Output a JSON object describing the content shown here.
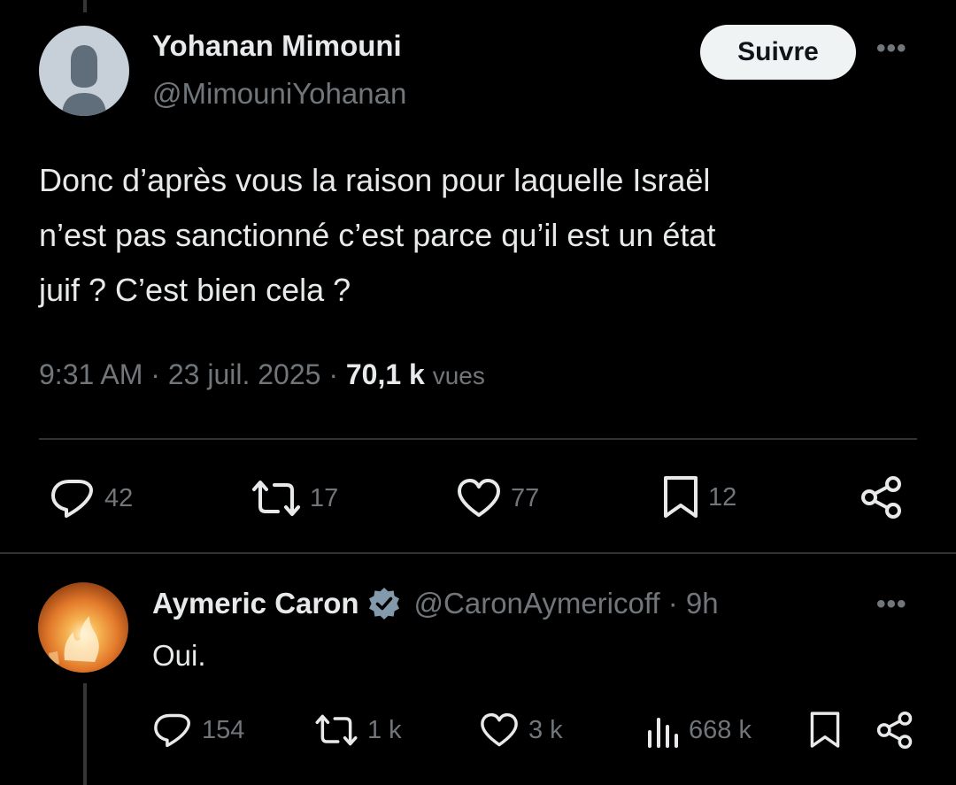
{
  "tweet": {
    "author_name": "Yohanan Mimouni",
    "author_handle": "@MimouniYohanan",
    "follow_label": "Suivre",
    "more_icon": "•••",
    "text_lines": [
      "Donc d’après vous la raison pour laquelle Israël",
      "n’est pas sanctionné c’est parce qu’il est un état",
      "juif ? C’est bien cela ?"
    ],
    "time": "9:31 AM",
    "date": "23 juil. 2025",
    "views_count": "70,1 k",
    "views_label": "vues",
    "actions": {
      "replies": "42",
      "reposts": "17",
      "likes": "77",
      "bookmarks": "12"
    }
  },
  "reply": {
    "author_name": "Aymeric Caron",
    "author_handle": "@CaronAymericoff",
    "time_ago": "9h",
    "more_icon": "•••",
    "text": "Oui.",
    "actions": {
      "replies": "154",
      "reposts": "1 k",
      "likes": "3 k",
      "views": "668 k"
    }
  },
  "icons": [
    "reply-icon",
    "repost-icon",
    "like-icon",
    "bookmark-icon",
    "share-icon",
    "views-icon",
    "verified-badge-icon",
    "more-icon"
  ],
  "colors": {
    "background": "#000000",
    "text_primary": "#e7e9ea",
    "text_secondary": "#71767b",
    "divider": "#2f3336",
    "follow_button_bg": "#eff3f4",
    "verified_badge": "#829aab"
  }
}
